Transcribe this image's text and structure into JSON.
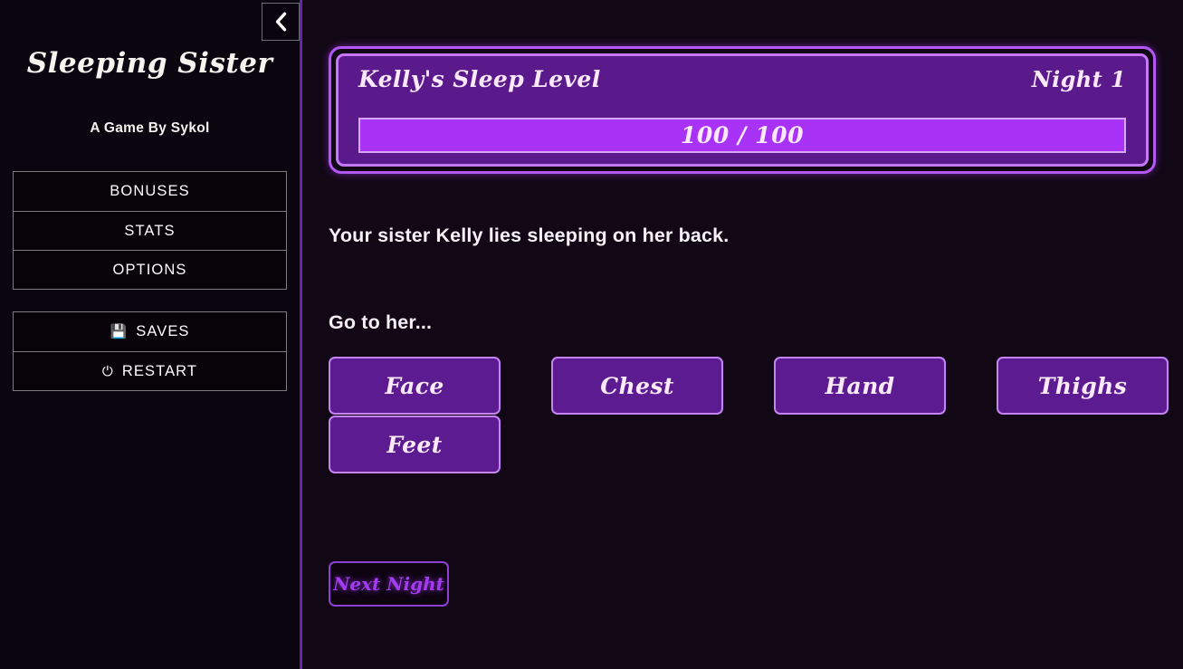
{
  "sidebar": {
    "collapse_icon": "chevron-left-icon",
    "title": "Sleeping Sister",
    "subtitle": "A Game By Sykol",
    "menu_main": [
      {
        "label": "BONUSES"
      },
      {
        "label": "STATS"
      },
      {
        "label": "OPTIONS"
      }
    ],
    "menu_system": [
      {
        "label": "SAVES",
        "icon": "floppy-disk-icon",
        "glyph": "💾"
      },
      {
        "label": "RESTART",
        "icon": "power-icon",
        "glyph": "⏻"
      }
    ]
  },
  "status": {
    "label": "Kelly's Sleep Level",
    "night": "Night 1",
    "meter_text": "100 / 100",
    "meter_current": 100,
    "meter_max": 100,
    "meter_percent": 100
  },
  "narrative": {
    "story": "Your sister Kelly lies sleeping on her back.",
    "prompt": "Go to her..."
  },
  "choices": {
    "column1": [
      {
        "label": "Face"
      },
      {
        "label": "Feet"
      }
    ],
    "column2": [
      {
        "label": "Chest"
      }
    ],
    "column3": [
      {
        "label": "Hand"
      }
    ],
    "column4": [
      {
        "label": "Thighs"
      }
    ]
  },
  "footer": {
    "next_night_label": "Next Night"
  },
  "colors": {
    "background": "#120815",
    "sidebar_background": "#0b0510",
    "accent_purple": "#a832f5",
    "panel_purple": "#5a1a8c",
    "border_light_purple": "#c584f3",
    "divider": "#6b21a8",
    "text_light": "#fbeafb"
  }
}
